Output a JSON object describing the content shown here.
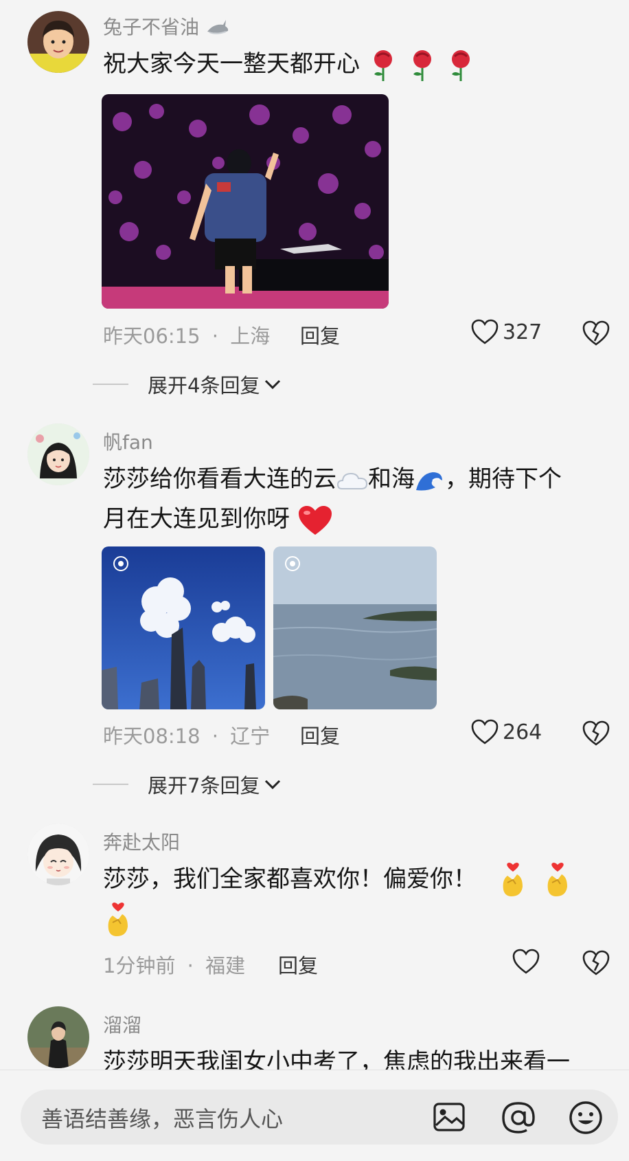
{
  "comments": [
    {
      "username": "兔子不省油",
      "text": "祝大家今天一整天都开心",
      "time": "昨天06:15",
      "sep": "·",
      "location": "上海",
      "reply_label": "回复",
      "likes": "327",
      "expand_label": "展开4条回复"
    },
    {
      "username": "帆fan",
      "text_a": "莎莎给你看看大连的云",
      "text_b": "和海",
      "text_c": "，期待下个",
      "text_line2": "月在大连见到你呀",
      "time": "昨天08:18",
      "sep": "·",
      "location": "辽宁",
      "reply_label": "回复",
      "likes": "264",
      "expand_label": "展开7条回复"
    },
    {
      "username": "奔赴太阳",
      "text": "莎莎，我们全家都喜欢你！偏爱你！",
      "time": "1分钟前",
      "sep": "·",
      "location": "福建",
      "reply_label": "回复"
    },
    {
      "username": "溜溜",
      "text": "莎莎明天我闺女小中考了，焦虑的我出来看一"
    }
  ],
  "input": {
    "placeholder": "善语结善缘，恶言伤人心"
  },
  "icons": [
    "shark-icon",
    "rose-icon",
    "heart-icon",
    "broken-heart-icon",
    "chevron-down-icon",
    "cloud-icon",
    "wave-icon",
    "red-heart-icon",
    "finger-heart-icon",
    "image-icon",
    "at-icon",
    "emoji-icon"
  ]
}
